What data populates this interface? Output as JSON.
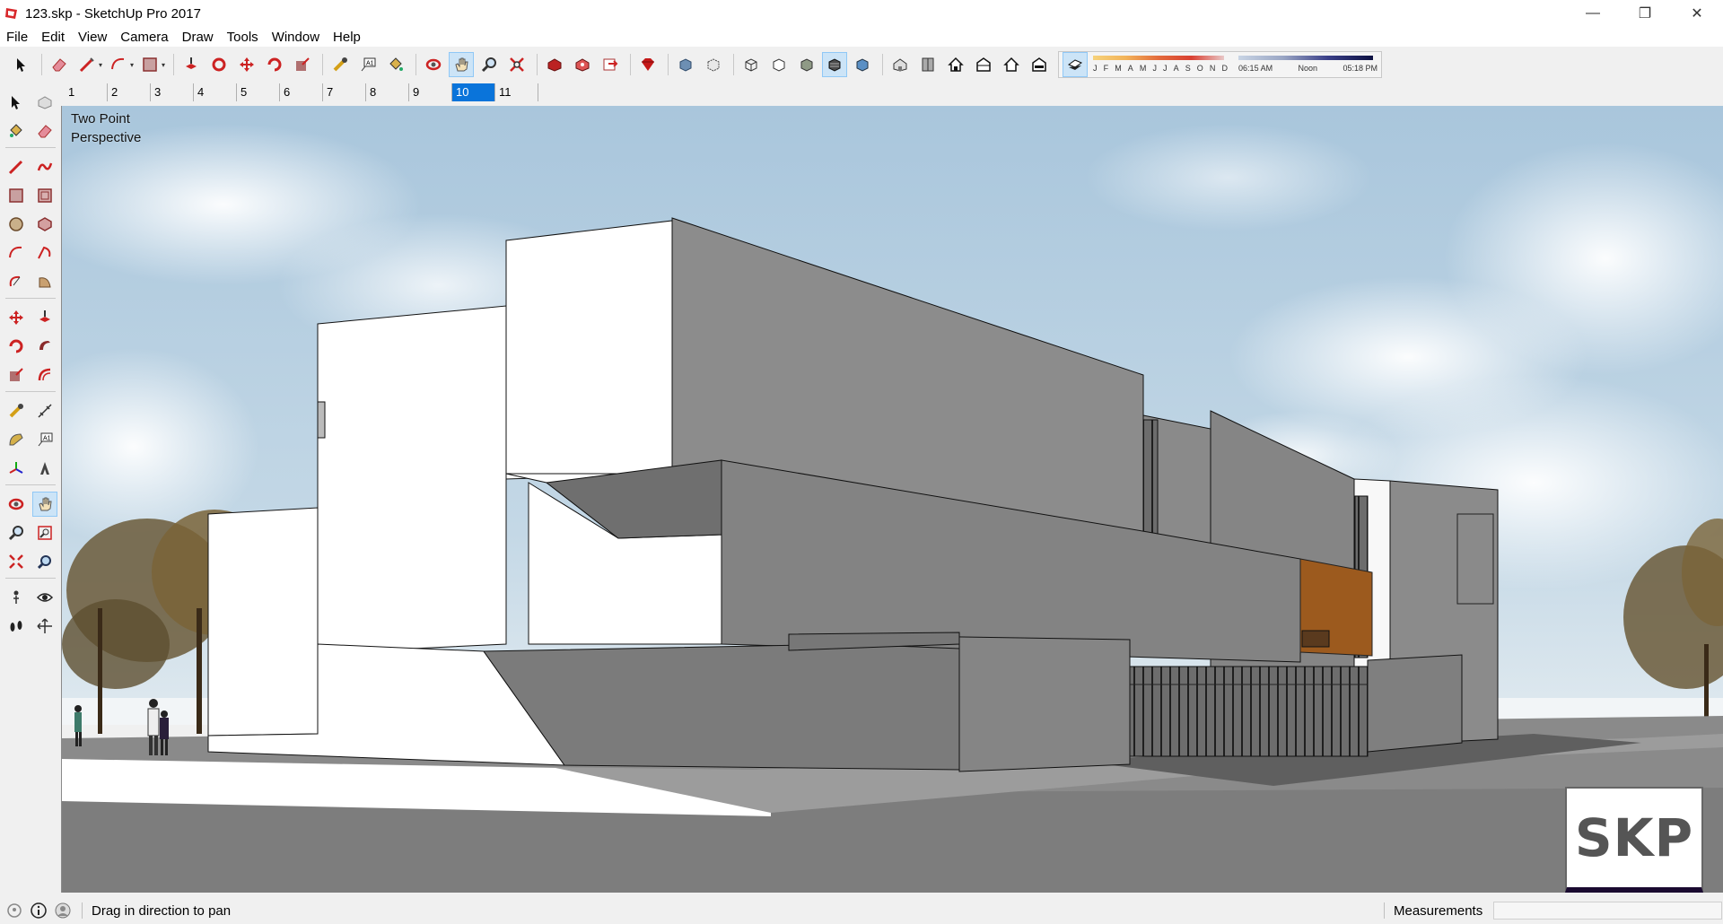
{
  "window": {
    "title": "123.skp - SketchUp Pro 2017",
    "minimize": "—",
    "maximize": "❐",
    "close": "✕"
  },
  "menu": [
    "File",
    "Edit",
    "View",
    "Camera",
    "Draw",
    "Tools",
    "Window",
    "Help"
  ],
  "shadow_settings": {
    "months": [
      "J",
      "F",
      "M",
      "A",
      "M",
      "J",
      "J",
      "A",
      "S",
      "O",
      "N",
      "D"
    ],
    "time_start": "06:15 AM",
    "time_mid": "Noon",
    "time_end": "05:18 PM"
  },
  "scenes": {
    "tabs": [
      "1",
      "2",
      "3",
      "4",
      "5",
      "6",
      "7",
      "8",
      "9",
      "10",
      "11"
    ],
    "active_index": 9
  },
  "viewport": {
    "camera_label_line1": "Two Point",
    "camera_label_line2": "Perspective",
    "badge": "SKP"
  },
  "statusbar": {
    "hint": "Drag in direction to pan",
    "measurements_label": "Measurements",
    "measurements_value": ""
  },
  "colors": {
    "sky_top": "#a9c6dc",
    "sky_bottom": "#dbe7ef",
    "wall_gray": "#8c8c8c",
    "wall_dark": "#787878",
    "white_face": "#ffffff",
    "wood_accent": "#9c5a1e",
    "active_tab": "#0a74da"
  },
  "toolbar_icons": [
    "select-icon",
    "eraser-icon",
    "line-icon",
    "arc-icon",
    "rectangle-icon",
    "push-pull-icon",
    "follow-me-icon",
    "move-icon",
    "rotate-icon",
    "scale-icon",
    "tape-measure-icon",
    "text-icon",
    "paint-bucket-icon",
    "orbit-icon",
    "pan-icon",
    "zoom-icon",
    "zoom-extents-icon",
    "warehouse-icon",
    "extension-warehouse-icon",
    "send-to-layout-icon",
    "ruby-icon",
    "xray-icon",
    "back-edges-icon",
    "wireframe-icon",
    "hidden-line-icon",
    "shaded-icon",
    "shaded-textures-icon",
    "monochrome-icon",
    "iso-view-icon",
    "top-view-icon",
    "front-view-icon",
    "right-view-icon",
    "back-view-icon",
    "left-view-icon",
    "shadows-icon"
  ]
}
